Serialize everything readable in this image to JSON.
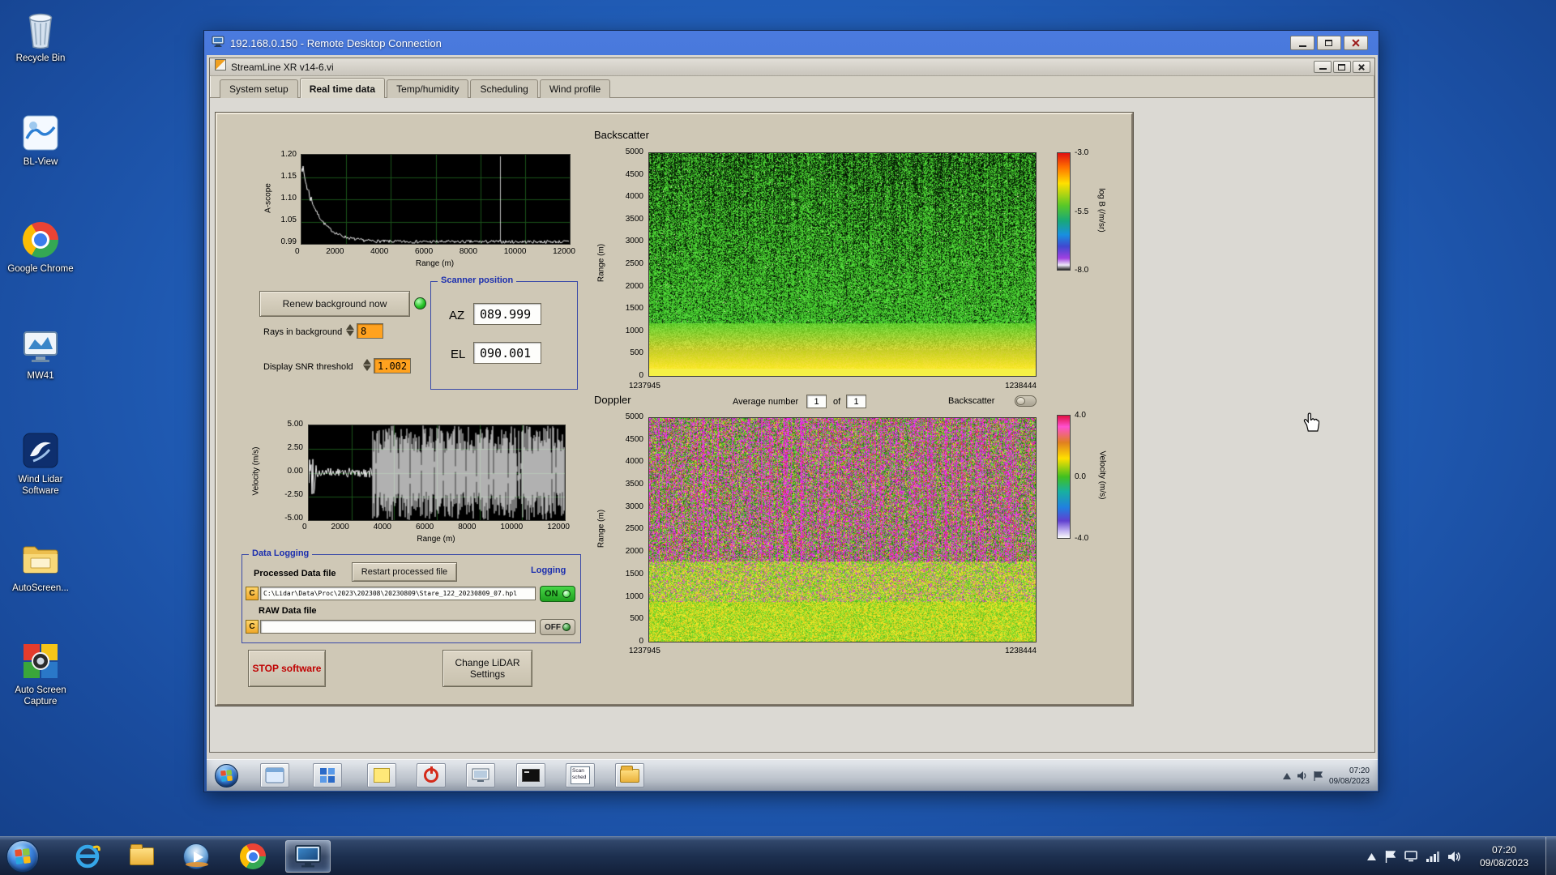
{
  "desktop": {
    "icons": [
      {
        "label": "Recycle Bin"
      },
      {
        "label": "BL-View"
      },
      {
        "label": "Google Chrome"
      },
      {
        "label": "MW41"
      },
      {
        "label": "Wind Lidar Software"
      },
      {
        "label": "AutoScreen..."
      },
      {
        "label": "Auto Screen Capture"
      }
    ]
  },
  "rdp": {
    "title": "192.168.0.150 - Remote Desktop Connection",
    "taskbar": {
      "scan_sched_label": "Scan sched",
      "time": "07:20",
      "date": "09/08/2023"
    }
  },
  "app": {
    "title": "StreamLine XR v14-6.vi",
    "tabs": [
      {
        "label": "System setup"
      },
      {
        "label": "Real time data"
      },
      {
        "label": "Temp/humidity"
      },
      {
        "label": "Scheduling"
      },
      {
        "label": "Wind profile"
      }
    ],
    "ascope": {
      "ylabel": "A-scope",
      "xlabel": "Range (m)",
      "yticks": [
        "1.20",
        "1.15",
        "1.10",
        "1.05",
        "0.99"
      ],
      "xticks": [
        "0",
        "2000",
        "4000",
        "6000",
        "8000",
        "10000",
        "12000"
      ]
    },
    "controls": {
      "renew": "Renew background now",
      "rays_label": "Rays in background",
      "rays_value": "8",
      "snr_label": "Display SNR threshold",
      "snr_value": "1.002"
    },
    "scanner": {
      "title": "Scanner position",
      "az_label": "AZ",
      "az_value": "089.999",
      "el_label": "EL",
      "el_value": "090.001"
    },
    "backscatter": {
      "title": "Backscatter",
      "ylabel": "Range (m)",
      "yticks": [
        "5000",
        "4500",
        "4000",
        "3500",
        "3000",
        "2500",
        "2000",
        "1500",
        "1000",
        "500",
        "0"
      ],
      "x_start": "1237945",
      "x_end": "1238444",
      "cb_ticks": [
        "-3.0",
        "-5.5",
        "-8.0"
      ],
      "cb_label": "log B (/m/sr)"
    },
    "doppler": {
      "title": "Doppler",
      "avg_label": "Average number",
      "avg_value": "1",
      "of_label": "of",
      "of_value": "1",
      "toggle_label": "Backscatter",
      "ylabel": "Range (m)",
      "yticks": [
        "5000",
        "4500",
        "4000",
        "3500",
        "3000",
        "2500",
        "2000",
        "1500",
        "1000",
        "500",
        "0"
      ],
      "x_start": "1237945",
      "x_end": "1238444",
      "cb_ticks": [
        "4.0",
        "0.0",
        "-4.0"
      ],
      "cb_label": "Velocity (m/s)"
    },
    "velocity": {
      "ylabel": "Velocity (m/s)",
      "xlabel": "Range (m)",
      "yticks": [
        "5.00",
        "2.50",
        "0.00",
        "-2.50",
        "-5.00"
      ],
      "xticks": [
        "0",
        "2000",
        "4000",
        "6000",
        "8000",
        "10000",
        "12000"
      ]
    },
    "logging": {
      "title": "Data Logging",
      "processed_label": "Processed Data file",
      "restart_button": "Restart processed file",
      "logging_label": "Logging",
      "drive": "C",
      "path": "C:\\Lidar\\Data\\Proc\\2023\\202308\\20230809\\Stare_122_20230809_07.hpl",
      "on": "ON",
      "raw_label": "RAW Data file",
      "off": "OFF"
    },
    "stop_button": "STOP software",
    "settings_button": "Change LiDAR Settings"
  },
  "host_taskbar": {
    "time": "07:20",
    "date": "09/08/2023"
  }
}
